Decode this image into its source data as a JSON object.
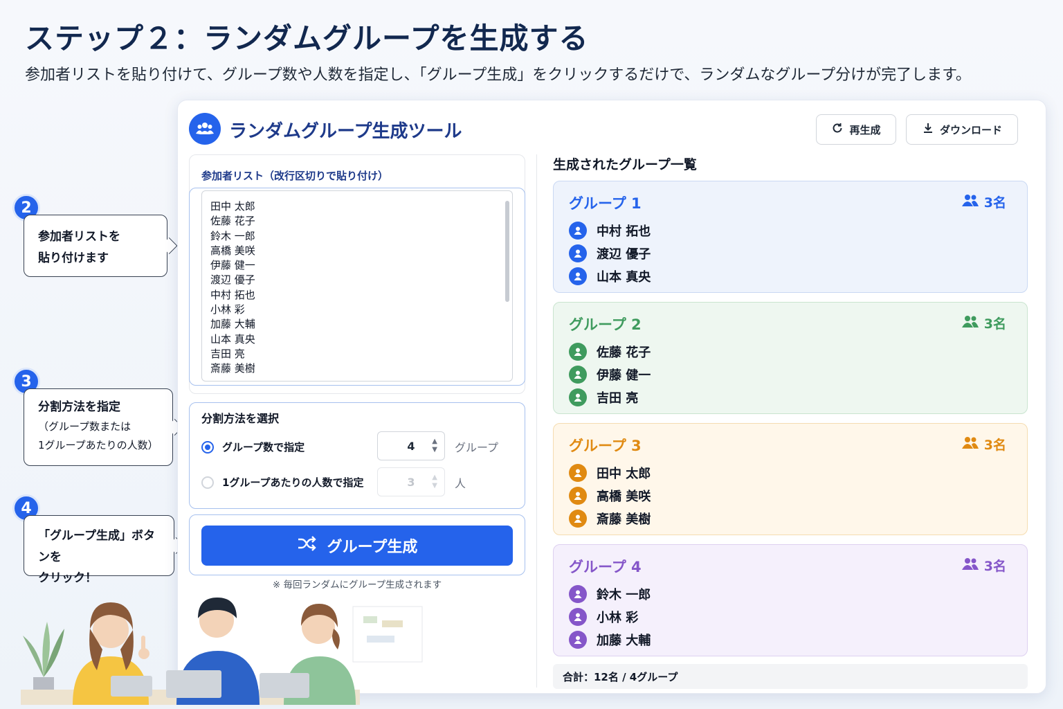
{
  "page": {
    "title": "ステップ２：ランダムグループを生成する",
    "subtitle": "参加者リストを貼り付けて、グループ数や人数を指定し、「グループ生成」をクリックするだけで、ランダムなグループ分けが完了します。"
  },
  "steps": [
    {
      "num": "2",
      "text1": "参加者リストを",
      "text2": "貼り付けます"
    },
    {
      "num": "3",
      "text1": "分割方法を指定",
      "text2": "（グループ数または",
      "text3": "1グループあたりの人数）"
    },
    {
      "num": "4",
      "text1": "「グループ生成」ボタンを",
      "text2": "クリック！"
    }
  ],
  "app": {
    "title": "ランダムグループ生成ツール",
    "regenerate_label": "再生成",
    "download_label": "ダウンロード",
    "list_label": "参加者リスト（改行区切りで貼り付け）",
    "participants": [
      "田中 太郎",
      "佐藤 花子",
      "鈴木 一郎",
      "高橋 美咲",
      "伊藤 健一",
      "渡辺 優子",
      "中村 拓也",
      "小林 彩",
      "加藤 大輔",
      "山本 真央",
      "吉田 亮",
      "斎藤 美樹"
    ],
    "split_title": "分割方法を選択",
    "option_groups_label": "グループ数で指定",
    "option_groups_value": "4",
    "option_groups_unit": "グループ",
    "option_people_label": "1グループあたりの人数で指定",
    "option_people_value": "3",
    "option_people_unit": "人",
    "generate_label": "グループ生成",
    "note": "※ 毎回ランダムにグループ生成されます",
    "groups_heading": "生成されたグループ一覧",
    "total": "合計：12名 / 4グループ"
  },
  "groups": [
    {
      "name": "グループ 1",
      "count": "3名",
      "color": "#2563eb",
      "bg": "#eef3fc",
      "border": "#c9d8f3",
      "members": [
        "中村 拓也",
        "渡辺 優子",
        "山本 真央"
      ]
    },
    {
      "name": "グループ 2",
      "count": "3名",
      "color": "#3f9b5e",
      "bg": "#eef7f0",
      "border": "#c9e4cf",
      "members": [
        "佐藤 花子",
        "伊藤 健一",
        "吉田 亮"
      ]
    },
    {
      "name": "グループ 3",
      "count": "3名",
      "color": "#e08a12",
      "bg": "#fff7ea",
      "border": "#f5dcb0",
      "members": [
        "田中 太郎",
        "高橋 美咲",
        "斎藤 美樹"
      ]
    },
    {
      "name": "グループ 4",
      "count": "3名",
      "color": "#8556c9",
      "bg": "#f5f0fc",
      "border": "#ddd0f0",
      "members": [
        "鈴木 一郎",
        "小林 彩",
        "加藤 大輔"
      ]
    }
  ]
}
